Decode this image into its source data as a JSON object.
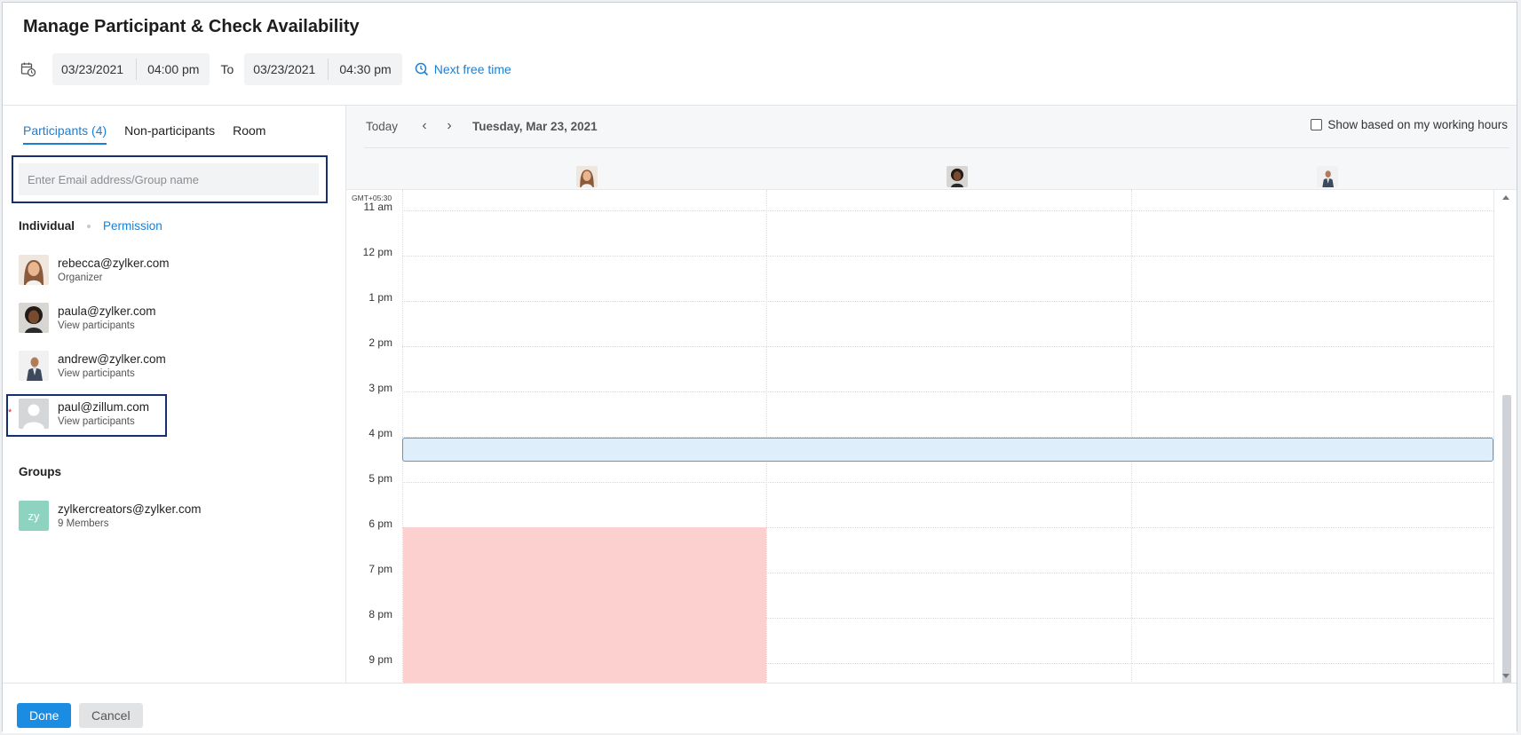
{
  "title": "Manage Participant & Check Availability",
  "date_range": {
    "from_date": "03/23/2021",
    "from_time": "04:00 pm",
    "to_label": "To",
    "to_date": "03/23/2021",
    "to_time": "04:30 pm",
    "next_free_time": "Next free time"
  },
  "tabs": [
    {
      "label": "Participants (4)",
      "active": true
    },
    {
      "label": "Non-participants",
      "active": false
    },
    {
      "label": "Room",
      "active": false
    }
  ],
  "search": {
    "placeholder": "Enter Email address/Group name",
    "value": ""
  },
  "subhead": {
    "individual": "Individual",
    "permission": "Permission"
  },
  "participants": [
    {
      "email": "rebecca@zylker.com",
      "sub": "Organizer",
      "avatar": "rebecca-avatar"
    },
    {
      "email": "paula@zylker.com",
      "sub": "View participants",
      "avatar": "paula-avatar"
    },
    {
      "email": "andrew@zylker.com",
      "sub": "View participants",
      "avatar": "andrew-avatar"
    },
    {
      "email": "paul@zillum.com",
      "sub": "View participants",
      "avatar": "default-user-avatar",
      "required_mark": "*"
    }
  ],
  "groups": {
    "heading": "Groups",
    "items": [
      {
        "initials": "zy",
        "email": "zylkercreators@zylker.com",
        "sub": "9 Members"
      }
    ]
  },
  "calendar": {
    "today": "Today",
    "date": "Tuesday, Mar 23, 2021",
    "working_hours_label": "Show based on my working hours",
    "working_hours_checked": false,
    "timezone": "GMT+05:30",
    "hours": [
      "11 am",
      "12 pm",
      "1 pm",
      "2 pm",
      "3 pm",
      "4 pm",
      "5 pm",
      "6 pm",
      "7 pm",
      "8 pm",
      "9 pm"
    ],
    "selected_slot": {
      "start": "4:00 pm",
      "end": "4:30 pm"
    },
    "busy": [
      {
        "participant": "rebecca@zylker.com",
        "start": "6:00 pm",
        "end": "9 pm+"
      }
    ],
    "colors": {
      "busy": "#fdd0d0",
      "selected": "#dfeefb",
      "accent": "#1a7fd4"
    }
  },
  "footer": {
    "done": "Done",
    "cancel": "Cancel"
  }
}
